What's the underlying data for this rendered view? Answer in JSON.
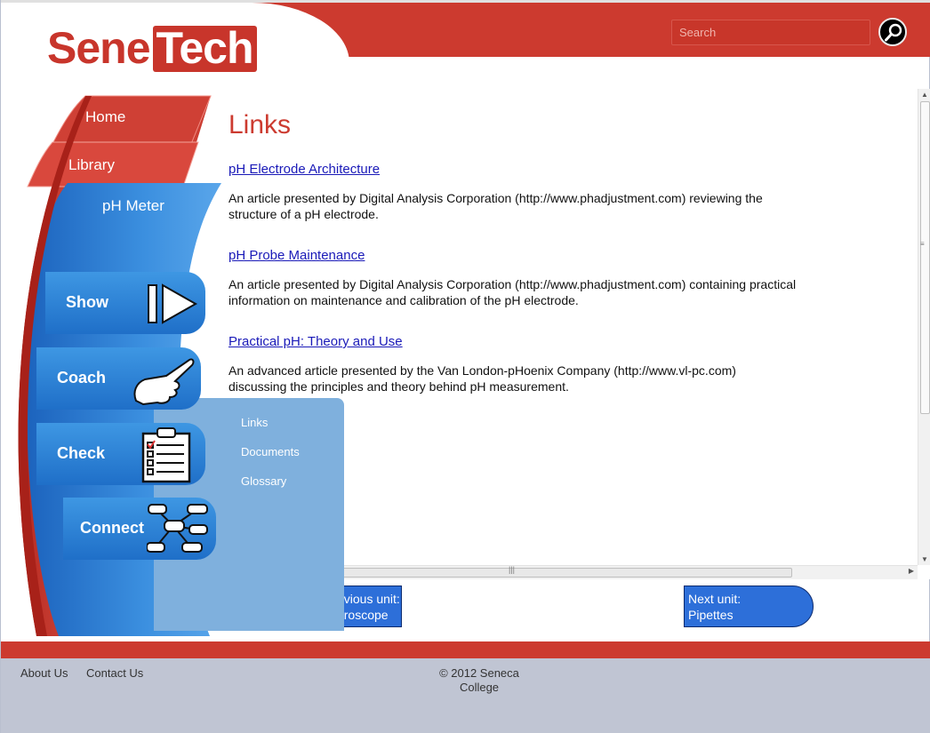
{
  "header": {
    "logo_part1": "Sene",
    "logo_part2": "Tech",
    "search_placeholder": "Search"
  },
  "nav": {
    "home": "Home",
    "library": "Library",
    "ph_meter": "pH Meter",
    "show": "Show",
    "coach": "Coach",
    "check": "Check",
    "connect": "Connect"
  },
  "submenu": [
    "Links",
    "Documents",
    "Glossary"
  ],
  "main": {
    "title": "Links",
    "links": [
      {
        "title": "pH Electrode Architecture",
        "desc": "An article presented by Digital Analysis Corporation (http://www.phadjustment.com) reviewing the structure of a pH electrode."
      },
      {
        "title": "pH Probe Maintenance",
        "desc": "An article presented by Digital Analysis Corporation (http://www.phadjustment.com) containing practical information on maintenance and calibration of the pH electrode."
      },
      {
        "title": "Practical pH: Theory and Use",
        "desc": "An advanced article presented by the Van London-pHoenix Company (http://www.vl-pc.com) discussing the principles and theory behind pH measurement."
      }
    ]
  },
  "units": {
    "prev_line1": "Previous unit:",
    "prev_line2": "Microscope",
    "next_line1": "Next unit:",
    "next_line2": "Pipettes"
  },
  "footer": {
    "about": "About Us",
    "contact": "Contact Us",
    "copyright": "© 2012 Seneca College"
  },
  "colors": {
    "brand_red": "#cc3a2f",
    "nav_blue": "#2f82d6",
    "footer_gray": "#c0c5d3"
  }
}
